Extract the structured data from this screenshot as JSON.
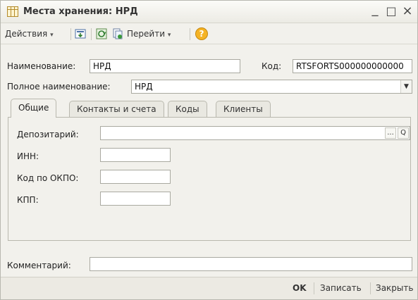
{
  "window": {
    "title": "Места хранения: НРД",
    "minimize_glyph": "_",
    "maximize_glyph": "□",
    "close_glyph": "×"
  },
  "toolbar": {
    "actions_label": "Действия",
    "goto_label": "Перейти",
    "help_glyph": "?",
    "dropdown_glyph": "▾"
  },
  "form": {
    "name_label": "Наименование:",
    "name_value": "НРД",
    "code_label": "Код:",
    "code_value": "RTSFORTS000000000000",
    "fullname_label": "Полное наименование:",
    "fullname_value": "НРД",
    "fullname_arrow": "▼"
  },
  "tabs": [
    {
      "label": "Общие",
      "active": true
    },
    {
      "label": "Контакты и счета",
      "active": false
    },
    {
      "label": "Коды",
      "active": false
    },
    {
      "label": "Клиенты",
      "active": false
    }
  ],
  "general": {
    "depository_label": "Депозитарий:",
    "depository_value": "",
    "select_glyph": "...",
    "open_glyph": "Q",
    "inn_label": "ИНН:",
    "inn_value": "",
    "okpo_label": "Код по ОКПО:",
    "okpo_value": "",
    "kpp_label": "КПП:",
    "kpp_value": ""
  },
  "comment": {
    "label": "Комментарий:",
    "value": ""
  },
  "buttons": {
    "ok_label": "OK",
    "save_label": "Записать",
    "close_label": "Закрыть"
  },
  "colors": {
    "window_bg": "#f2f1ec",
    "field_border": "#a9a9a0",
    "title_icon": "#b28a2a"
  }
}
